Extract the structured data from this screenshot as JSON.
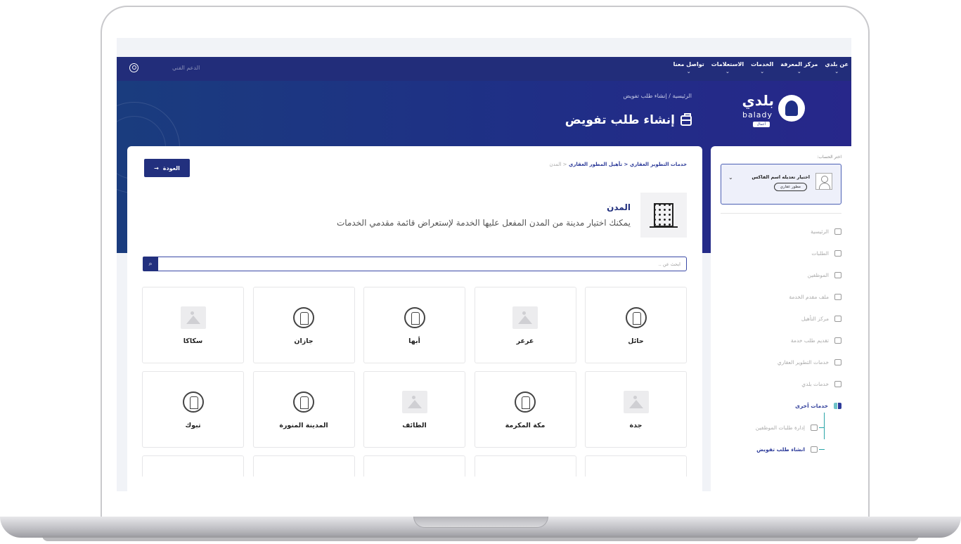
{
  "topnav": {
    "items": [
      {
        "label": "عن بلدي"
      },
      {
        "label": "مركز المعرفة"
      },
      {
        "label": "الخدمات"
      },
      {
        "label": "الاستعلامات"
      },
      {
        "label": "تواصل معنا"
      }
    ],
    "support_label": "الدعم الفني"
  },
  "hero": {
    "breadcrumb": "الرئيسية / إنشاء طلب تفويض",
    "title": "إنشاء طلب تفويض"
  },
  "logo": {
    "word_ar": "بلدي",
    "word_en": "balady",
    "badge": "أعمال"
  },
  "sidebar": {
    "account_label": "اختر الحساب:",
    "account_name": "اختيار تعديله اسم الفاكس",
    "account_role": "مطور عقاري",
    "menu": [
      {
        "label": "الرئيسية",
        "icon": "home-icon"
      },
      {
        "label": "الطلبات",
        "icon": "requests-icon"
      },
      {
        "label": "الموظفين",
        "icon": "employees-icon"
      },
      {
        "label": "ملف مقدم الخدمة",
        "icon": "briefcase-icon"
      },
      {
        "label": "مركز التأهيل",
        "icon": "table-icon"
      },
      {
        "label": "تقديم طلب خدمة",
        "icon": "submit-icon"
      },
      {
        "label": "خدمات التطوير العقاري",
        "icon": "buildings-icon"
      },
      {
        "label": "خدمات بلدي",
        "icon": "services-icon"
      },
      {
        "label": "خدمات أخرى",
        "icon": "grid-icon"
      }
    ],
    "submenu": [
      {
        "label": "إدارة طلبات الموظفين"
      },
      {
        "label": "انشاء طلب تفويض"
      }
    ]
  },
  "main": {
    "crumbs": {
      "part1": "خدمات التطوير العقاري",
      "part2": "تأهيل المطور العقاري",
      "part3": "المدن"
    },
    "back_label": "العودة",
    "section_title": "المدن",
    "section_desc": "يمكنك اختيار مدينة من المدن المفعل عليها الخدمة لإستعراض قائمة مقدمي الخدمات",
    "search_placeholder": "ابحث عن ..",
    "cities": [
      {
        "name": "حائل",
        "icon": "city-landmark-icon"
      },
      {
        "name": "عرعر",
        "icon": "image-placeholder-icon"
      },
      {
        "name": "أبها",
        "icon": "city-landmark-icon"
      },
      {
        "name": "جازان",
        "icon": "city-landmark-icon"
      },
      {
        "name": "سكاكا",
        "icon": "image-placeholder-icon"
      },
      {
        "name": "جدة",
        "icon": "image-placeholder-icon"
      },
      {
        "name": "مكة المكرمة",
        "icon": "city-landmark-icon"
      },
      {
        "name": "الطائف",
        "icon": "image-placeholder-icon"
      },
      {
        "name": "المدينة المنورة",
        "icon": "city-landmark-icon"
      },
      {
        "name": "تبوك",
        "icon": "city-landmark-icon"
      }
    ]
  },
  "colors": {
    "primary": "#22307e",
    "accent": "#2aa5a8"
  }
}
